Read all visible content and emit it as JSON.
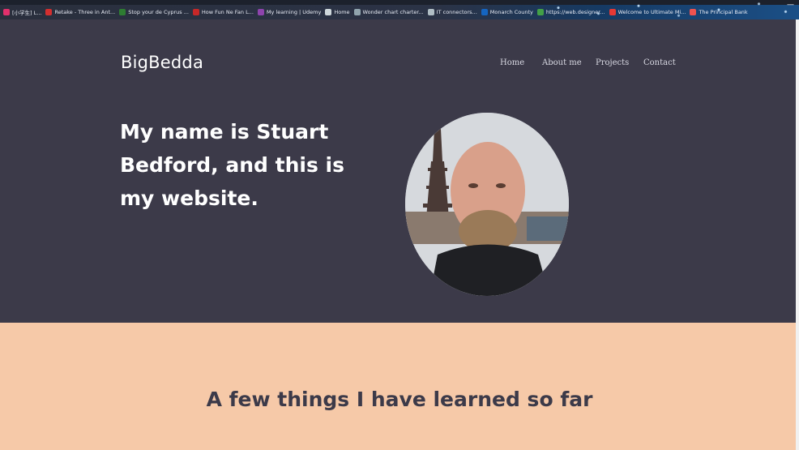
{
  "bookmarks": [
    {
      "label": "[小学生] L...",
      "color": "#e1306c"
    },
    {
      "label": "Retake - Three in Ant...",
      "color": "#d32f2f"
    },
    {
      "label": "Stop your de Cyprus ...",
      "color": "#2e7d32"
    },
    {
      "label": "How Fun Ne Fan L...",
      "color": "#c62828"
    },
    {
      "label": "My learning | Udemy",
      "color": "#8e44ad"
    },
    {
      "label": "Home",
      "color": "#cfd8dc"
    },
    {
      "label": "Wonder chart charter...",
      "color": "#90a4ae"
    },
    {
      "label": "IT connectors...",
      "color": "#b0bec5"
    },
    {
      "label": "Monarch County",
      "color": "#1565c0"
    },
    {
      "label": "https://web.designer...",
      "color": "#43a047"
    },
    {
      "label": "Welcome to Ultimate Mi...",
      "color": "#e53935"
    },
    {
      "label": "The Principal Bank",
      "color": "#ef5350"
    }
  ],
  "site": {
    "brand": "BigBedda",
    "nav": [
      "Home",
      "About me",
      "Projects",
      "Contact"
    ],
    "headline": "My name is Stuart Bedford, and this is my website.",
    "section_title": "A few things I have learned so far"
  },
  "colors": {
    "hero_bg": "#3c3a49",
    "section_bg": "#f6c9a8",
    "heading_dark": "#3c3a49"
  }
}
